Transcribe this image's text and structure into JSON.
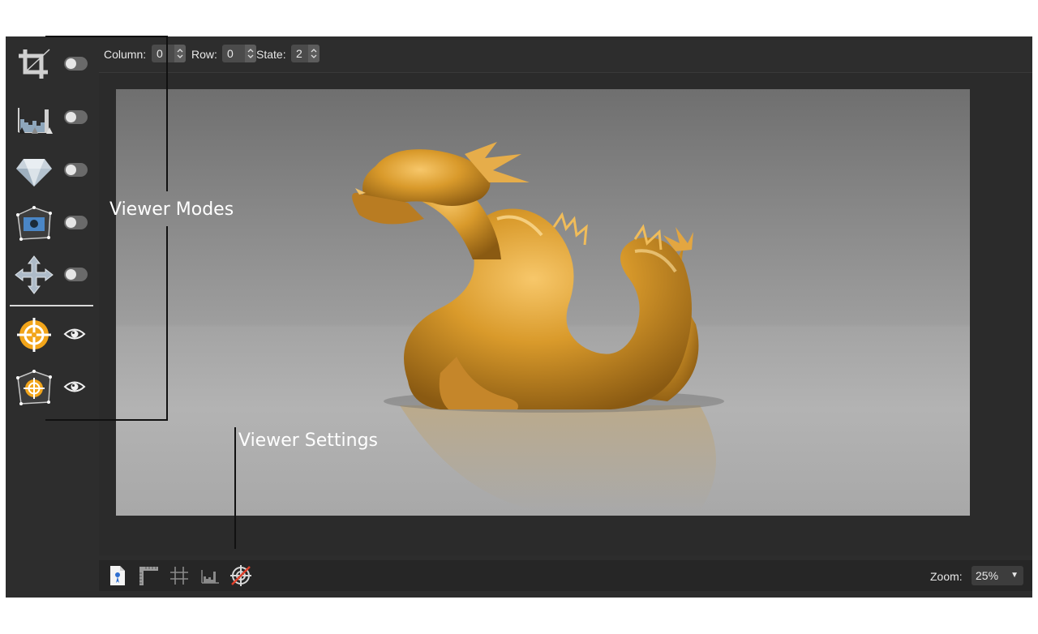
{
  "toolbar": {
    "column_label": "Column:",
    "column_value": "0",
    "row_label": "Row:",
    "row_value": "0",
    "state_label": "State:",
    "state_value": "2"
  },
  "sidebar": {
    "modes": [
      {
        "icon": "crop-icon",
        "toggle": false
      },
      {
        "icon": "histogram-icon",
        "toggle": false
      },
      {
        "icon": "diamond-icon",
        "toggle": false
      },
      {
        "icon": "camera-frame-icon",
        "toggle": false
      },
      {
        "icon": "move-arrows-icon",
        "toggle": false
      }
    ],
    "settings": [
      {
        "icon": "target-icon",
        "visibility": "eye-icon"
      },
      {
        "icon": "frame-target-icon",
        "visibility": "eye-icon"
      }
    ]
  },
  "bottom_bar": {
    "icons": [
      "document-pin-icon",
      "ruler-corner-icon",
      "grid-icon",
      "histogram-small-icon",
      "crosshair-off-icon"
    ],
    "zoom_label": "Zoom:",
    "zoom_value": "25%"
  },
  "callouts": {
    "viewer_modes": "Viewer Modes",
    "viewer_settings": "Viewer Settings"
  },
  "colors": {
    "panel": "#2d2d2d",
    "accent_gold": "#f2a51a",
    "dragon_gold": "#d99a2b"
  }
}
